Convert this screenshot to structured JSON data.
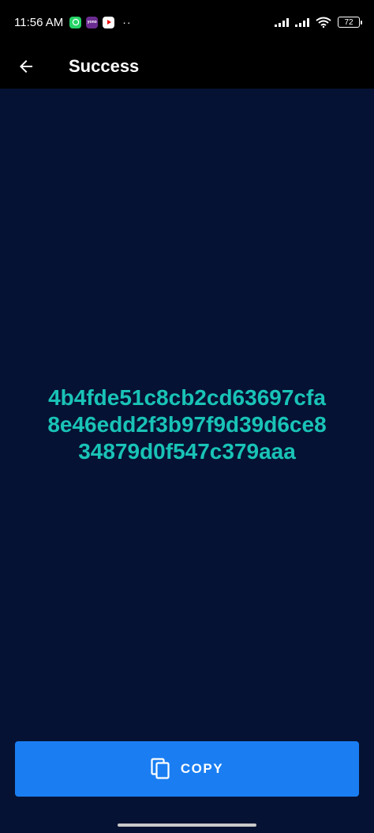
{
  "status_bar": {
    "time": "11:56 AM",
    "notification_icons": [
      "whatsapp-icon",
      "vodafone-icon",
      "youtube-icon"
    ],
    "vodafone_badge_text": "yono",
    "more_indicator": "··",
    "battery_level": "72"
  },
  "app_bar": {
    "back_icon": "arrow-left-icon",
    "title": "Success"
  },
  "main": {
    "hash_lines": "4b4fde51c8cb2cd63697cfa\n8e46edd2f3b97f9d39d6ce8\n34879d0f547c379aaa"
  },
  "copy_button": {
    "icon": "copy-icon",
    "label": "COPY"
  },
  "colors": {
    "background": "#061233",
    "hash_text": "#19c3b7",
    "button": "#1a7ef2",
    "bars": "#000000"
  }
}
